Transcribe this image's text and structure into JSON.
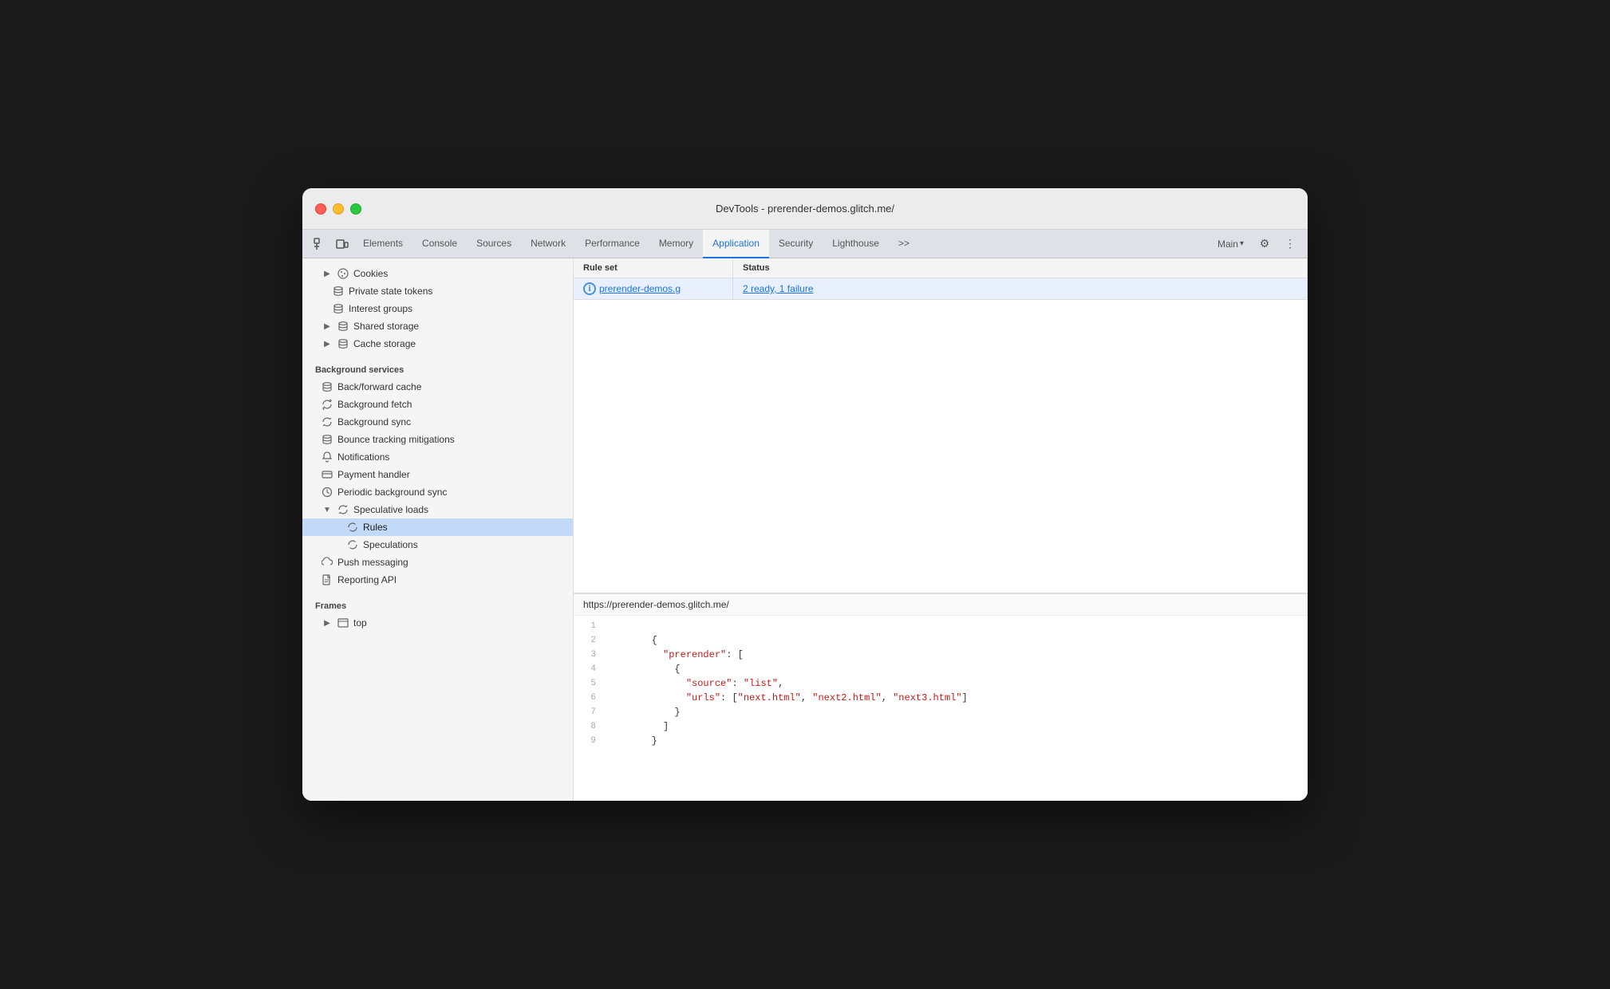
{
  "window": {
    "title": "DevTools - prerender-demos.glitch.me/"
  },
  "tabs": {
    "items": [
      {
        "label": "Elements",
        "active": false
      },
      {
        "label": "Console",
        "active": false
      },
      {
        "label": "Sources",
        "active": false
      },
      {
        "label": "Network",
        "active": false
      },
      {
        "label": "Performance",
        "active": false
      },
      {
        "label": "Memory",
        "active": false
      },
      {
        "label": "Application",
        "active": true
      },
      {
        "label": "Security",
        "active": false
      },
      {
        "label": "Lighthouse",
        "active": false
      }
    ],
    "more_label": ">>",
    "main_label": "Main",
    "settings_icon": "⚙",
    "more_icon": "⋮"
  },
  "sidebar": {
    "sections": {
      "storage_items": [
        {
          "label": "Cookies",
          "icon": "expand-right",
          "indent": 0
        },
        {
          "label": "Private state tokens",
          "icon": "db",
          "indent": 1
        },
        {
          "label": "Interest groups",
          "icon": "db",
          "indent": 1
        },
        {
          "label": "Shared storage",
          "icon": "db",
          "indent": 1,
          "expand": true
        },
        {
          "label": "Cache storage",
          "icon": "db",
          "indent": 1,
          "expand": true
        }
      ],
      "background_services_header": "Background services",
      "background_services": [
        {
          "label": "Back/forward cache",
          "icon": "db"
        },
        {
          "label": "Background fetch",
          "icon": "sync"
        },
        {
          "label": "Background sync",
          "icon": "sync"
        },
        {
          "label": "Bounce tracking mitigations",
          "icon": "db"
        },
        {
          "label": "Notifications",
          "icon": "bell"
        },
        {
          "label": "Payment handler",
          "icon": "card"
        },
        {
          "label": "Periodic background sync",
          "icon": "clock"
        },
        {
          "label": "Speculative loads",
          "icon": "sync",
          "expanded": true
        }
      ],
      "speculative_loads_children": [
        {
          "label": "Rules",
          "active": true
        },
        {
          "label": "Speculations"
        }
      ],
      "more_background_services": [
        {
          "label": "Push messaging",
          "icon": "cloud"
        },
        {
          "label": "Reporting API",
          "icon": "file"
        }
      ],
      "frames_header": "Frames",
      "frames": [
        {
          "label": "top",
          "icon": "frame",
          "expand": true
        }
      ]
    }
  },
  "table": {
    "columns": [
      "Rule set",
      "Status"
    ],
    "rows": [
      {
        "rule_set": "prerender-demos.g",
        "status": "2 ready, 1 failure",
        "icon": "info"
      }
    ]
  },
  "bottom_panel": {
    "url": "https://prerender-demos.glitch.me/",
    "code_lines": [
      {
        "num": "1",
        "content": ""
      },
      {
        "num": "2",
        "content": "        {"
      },
      {
        "num": "3",
        "content": "          \"prerender\": ["
      },
      {
        "num": "4",
        "content": "            {"
      },
      {
        "num": "5",
        "content": "              \"source\": \"list\","
      },
      {
        "num": "6",
        "content": "              \"urls\": [\"next.html\", \"next2.html\", \"next3.html\"]"
      },
      {
        "num": "7",
        "content": "            }"
      },
      {
        "num": "8",
        "content": "          ]"
      },
      {
        "num": "9",
        "content": "        }"
      }
    ]
  }
}
